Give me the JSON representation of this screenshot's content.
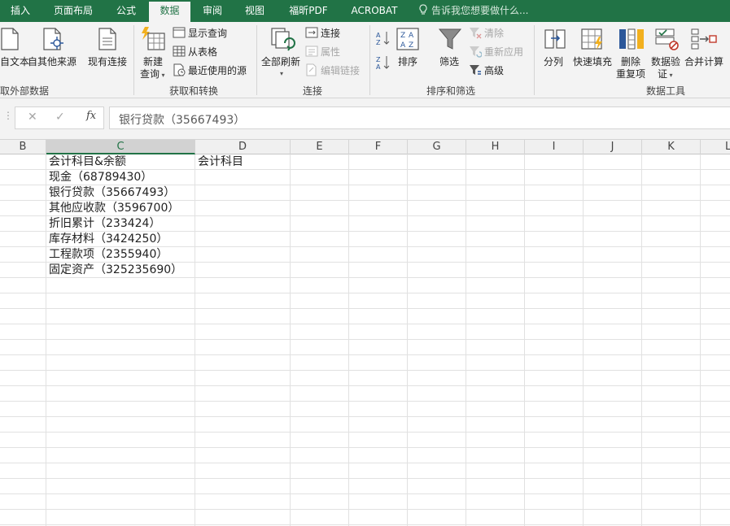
{
  "tabs": [
    {
      "label": "插入",
      "active": false
    },
    {
      "label": "页面布局",
      "active": false
    },
    {
      "label": "公式",
      "active": false
    },
    {
      "label": "数据",
      "active": true
    },
    {
      "label": "审阅",
      "active": false
    },
    {
      "label": "视图",
      "active": false
    },
    {
      "label": "福昕PDF",
      "active": false
    },
    {
      "label": "ACROBAT",
      "active": false
    }
  ],
  "tell_me": "告诉我您想要做什么...",
  "ribbon": {
    "external": {
      "from_text": "自文本",
      "from_other": "自其他来源",
      "existing": "现有连接",
      "group": "取外部数据"
    },
    "transform": {
      "new_query": "新建",
      "new_query2": "查询",
      "show_query": "显示查询",
      "from_table": "从表格",
      "recent": "最近使用的源",
      "group": "获取和转换"
    },
    "connections": {
      "refresh_all": "全部刷新",
      "connections": "连接",
      "properties": "属性",
      "edit_links": "编辑链接",
      "group": "连接"
    },
    "sort_filter": {
      "sort": "排序",
      "filter": "筛选",
      "clear": "清除",
      "reapply": "重新应用",
      "advanced": "高级",
      "group": "排序和筛选"
    },
    "tools": {
      "split": "分列",
      "flash_fill": "快速填充",
      "remove_dup": "删除",
      "remove_dup2": "重复项",
      "validation": "数据验",
      "validation2": "证",
      "consolidate": "合并计算",
      "group": "数据工具"
    }
  },
  "formula_bar": {
    "content": "银行贷款（35667493）"
  },
  "columns": [
    "B",
    "C",
    "D",
    "E",
    "F",
    "G",
    "H",
    "I",
    "J",
    "K",
    "L"
  ],
  "selected_column": "C",
  "cells": {
    "c_header": "会计科目&余额",
    "d_header": "会计科目",
    "rows": [
      "现金（68789430）",
      "银行贷款（35667493）",
      "其他应收款（3596700）",
      "折旧累计（233424）",
      "库存材料（3424250）",
      "工程款项（2355940）",
      "固定资产（325235690）"
    ]
  },
  "colors": {
    "accent": "#217346",
    "ribbon_bg": "#f3f3f3",
    "grid_line": "#e1e1e1"
  }
}
